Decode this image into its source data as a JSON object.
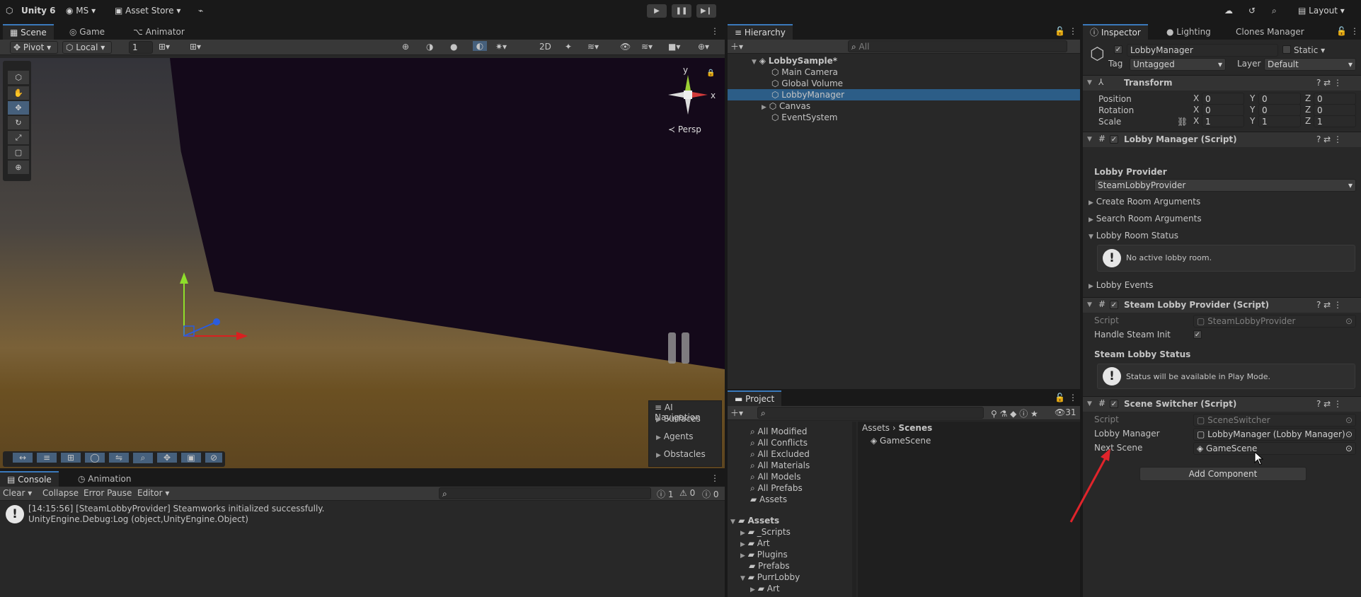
{
  "toolbar": {
    "product": "Unity 6",
    "account": "MS",
    "asset_store": "Asset Store",
    "layout": "Layout"
  },
  "scene_panel": {
    "tabs": [
      "Scene",
      "Game",
      "Animator"
    ],
    "pivot": "Pivot",
    "local": "Local",
    "snap_value": "1",
    "gizmo_persp": "Persp",
    "gizmo_y": "y",
    "gizmo_x": "x",
    "overlay": {
      "title": "AI Navigation",
      "items": [
        "Surfaces",
        "Agents",
        "Obstacles"
      ]
    }
  },
  "console_panel": {
    "tabs": [
      "Console",
      "Animation"
    ],
    "buttons": {
      "clear": "Clear",
      "collapse": "Collapse",
      "error_pause": "Error Pause",
      "editor": "Editor"
    },
    "counts": {
      "info": "1",
      "warn": "0",
      "error": "0"
    },
    "messages": [
      {
        "line1": "[14:15:56] [SteamLobbyProvider] Steamworks initialized successfully.",
        "line2": "UnityEngine.Debug:Log (object,UnityEngine.Object)"
      }
    ]
  },
  "hierarchy": {
    "tab": "Hierarchy",
    "search_placeholder": "All",
    "scene": "LobbySample*",
    "items": [
      "Main Camera",
      "Global Volume",
      "LobbyManager",
      "Canvas",
      "EventSystem"
    ]
  },
  "project": {
    "tab": "Project",
    "hidden_count": "31",
    "favorites": [
      "All Modified",
      "All Conflicts",
      "All Excluded",
      "All Materials",
      "All Models",
      "All Prefabs",
      "Assets"
    ],
    "tree_root": "Assets",
    "tree": [
      "_Scripts",
      "Art",
      "Plugins",
      "Prefabs",
      "PurrLobby",
      "Art"
    ],
    "breadcrumb": [
      "Assets",
      "Scenes"
    ],
    "files": [
      "GameScene"
    ]
  },
  "inspector": {
    "tabs": [
      "Inspector",
      "Lighting",
      "Clones Manager"
    ],
    "object_name": "LobbyManager",
    "static_label": "Static",
    "tag_label": "Tag",
    "tag_value": "Untagged",
    "layer_label": "Layer",
    "layer_value": "Default",
    "transform": {
      "title": "Transform",
      "rows": [
        {
          "label": "Position",
          "x": "0",
          "y": "0",
          "z": "0"
        },
        {
          "label": "Rotation",
          "x": "0",
          "y": "0",
          "z": "0"
        },
        {
          "label": "Scale",
          "x": "1",
          "y": "1",
          "z": "1"
        }
      ]
    },
    "lobby_manager": {
      "title": "Lobby Manager (Script)",
      "provider_label": "Lobby Provider",
      "provider_value": "SteamLobbyProvider",
      "foldouts": [
        "Create Room Arguments",
        "Search Room Arguments",
        "Lobby Room Status"
      ],
      "status_msg": "No active lobby room.",
      "events": "Lobby Events"
    },
    "steam_provider": {
      "title": "Steam Lobby Provider (Script)",
      "script_label": "Script",
      "script_value": "SteamLobbyProvider",
      "handle_label": "Handle Steam Init",
      "status_header": "Steam Lobby Status",
      "status_msg": "Status will be available in Play Mode."
    },
    "scene_switcher": {
      "title": "Scene Switcher (Script)",
      "script_label": "Script",
      "script_value": "SceneSwitcher",
      "lobby_manager_label": "Lobby Manager",
      "lobby_manager_value": "LobbyManager (Lobby Manager)",
      "next_scene_label": "Next Scene",
      "next_scene_value": "GameScene"
    },
    "add_component": "Add Component"
  },
  "colors": {
    "accent": "#3a79bb",
    "selection": "#2c5d87",
    "annotation_arrow": "#e0242b"
  }
}
